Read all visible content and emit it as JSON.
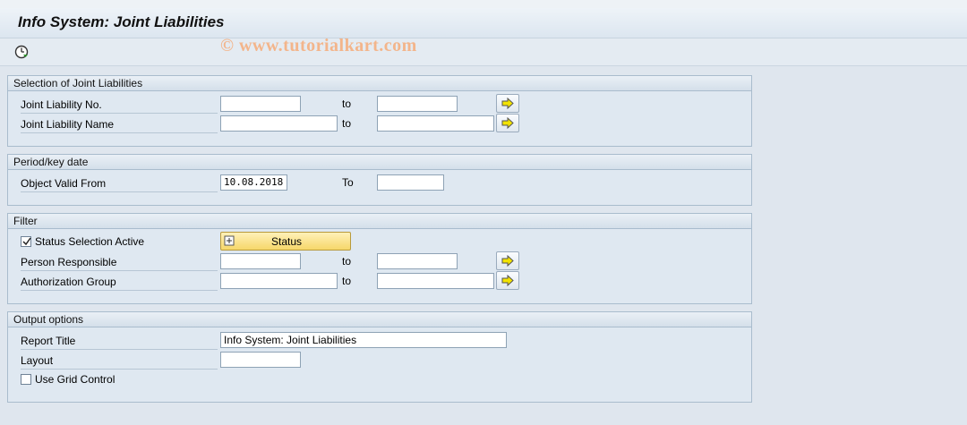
{
  "title": "Info System: Joint Liabilities",
  "watermark": "© www.tutorialkart.com",
  "toolbar": {
    "execute_icon": "execute-clock-icon"
  },
  "groups": {
    "selection": {
      "title": "Selection of Joint Liabilities",
      "rows": [
        {
          "label": "Joint Liability No.",
          "from": "",
          "to_label": "to",
          "to": ""
        },
        {
          "label": "Joint Liability Name",
          "from": "",
          "to_label": "to",
          "to": ""
        }
      ]
    },
    "period": {
      "title": "Period/key date",
      "rows": [
        {
          "label": "Object Valid From",
          "from": "10.08.2018",
          "to_label": "To",
          "to": ""
        }
      ]
    },
    "filter": {
      "title": "Filter",
      "status_checkbox": {
        "label": "Status Selection Active",
        "checked": true
      },
      "status_button": "Status",
      "rows": [
        {
          "label": "Person Responsible",
          "from": "",
          "to_label": "to",
          "to": ""
        },
        {
          "label": "Authorization Group",
          "from": "",
          "to_label": "to",
          "to": ""
        }
      ]
    },
    "output": {
      "title": "Output options",
      "report_title_label": "Report Title",
      "report_title_value": "Info System: Joint Liabilities",
      "layout_label": "Layout",
      "layout_value": "",
      "grid_checkbox": {
        "label": "Use Grid Control",
        "checked": false
      }
    }
  },
  "colors": {
    "accent_yellow": "#f6d76a",
    "arrow_yellow": "#f2e300",
    "panel_bg": "#dfe8f1"
  }
}
